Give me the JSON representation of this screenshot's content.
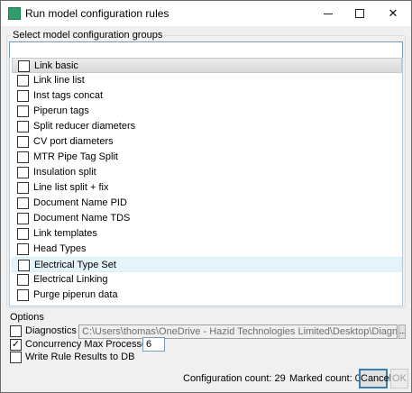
{
  "window": {
    "title": "Run model configuration rules",
    "controls": {
      "minimize": "—",
      "maximize": "☐",
      "close": "✕"
    }
  },
  "groups": {
    "legend": "Select model configuration groups",
    "filter_value": "",
    "items": [
      {
        "label": "Link basic",
        "checked": false,
        "state": "selected"
      },
      {
        "label": "Link line list",
        "checked": false
      },
      {
        "label": "Inst tags concat",
        "checked": false
      },
      {
        "label": "Piperun tags",
        "checked": false
      },
      {
        "label": "Split reducer diameters",
        "checked": false
      },
      {
        "label": "CV port diameters",
        "checked": false
      },
      {
        "label": "MTR Pipe Tag Split",
        "checked": false
      },
      {
        "label": "Insulation split",
        "checked": false
      },
      {
        "label": "Line list split + fix",
        "checked": false
      },
      {
        "label": "Document Name PID",
        "checked": false
      },
      {
        "label": "Document Name TDS",
        "checked": false
      },
      {
        "label": "Link templates",
        "checked": false
      },
      {
        "label": "Head Types",
        "checked": false
      },
      {
        "label": "Electrical Type Set",
        "checked": false,
        "state": "hover"
      },
      {
        "label": "Electrical Linking",
        "checked": false
      },
      {
        "label": "Purge piperun data",
        "checked": false
      }
    ]
  },
  "options": {
    "legend": "Options",
    "diagnostics": {
      "label": "Diagnostics",
      "checked": false,
      "path": "C:\\Users\\thomas\\OneDrive - Hazid Technologies Limited\\Desktop\\Diagnostics",
      "browse_label": "..."
    },
    "concurrency": {
      "label": "Concurrency Max Processes:",
      "checked": true,
      "check_glyph": "✓",
      "value": "6"
    },
    "write_results": {
      "label": "Write Rule Results to DB",
      "checked": false
    }
  },
  "status": {
    "configuration_count": "Configuration count: 29",
    "marked_count": "Marked count: 0"
  },
  "buttons": {
    "cancel": "Cancel",
    "ok": "OK"
  }
}
